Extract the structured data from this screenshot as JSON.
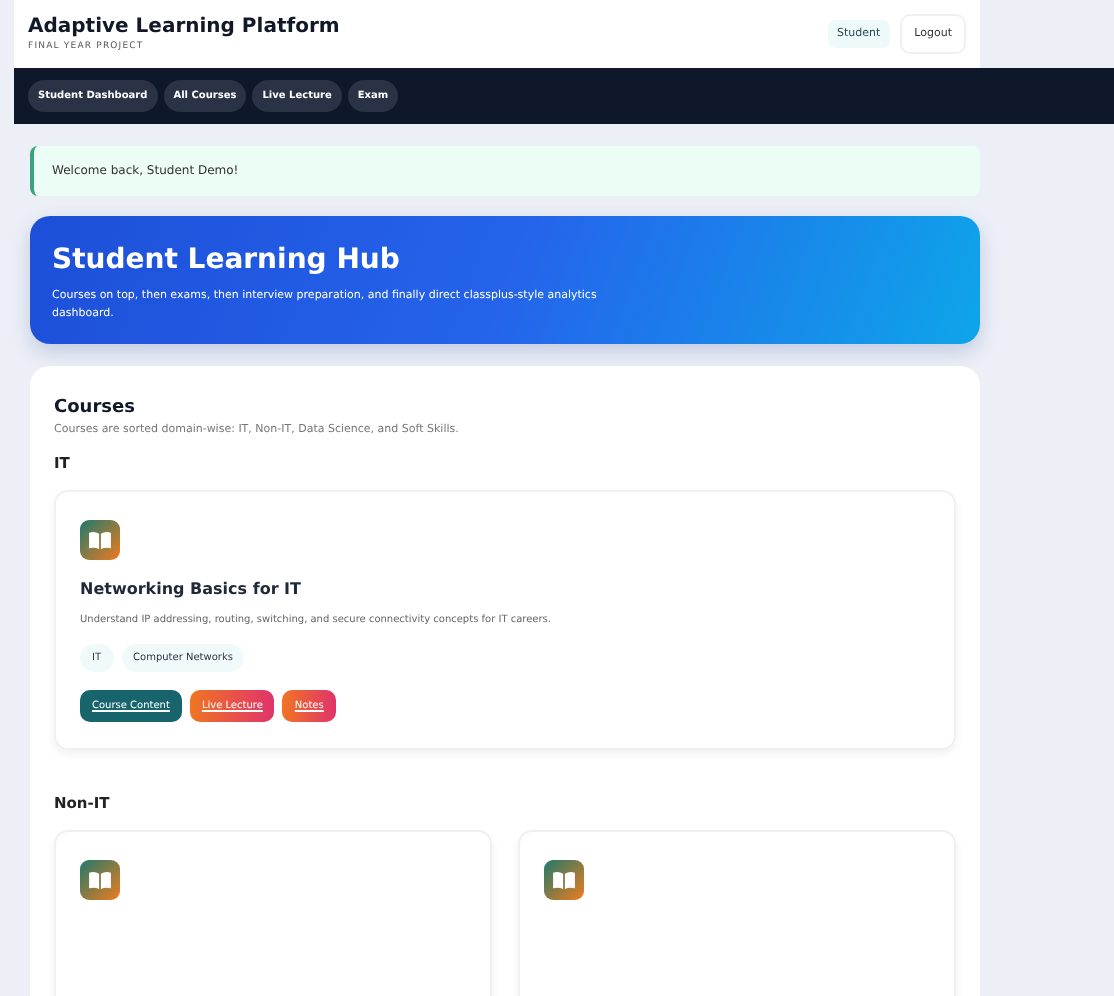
{
  "header": {
    "title": "Adaptive Learning Platform",
    "subtitle": "FINAL YEAR PROJECT",
    "role_badge": "Student",
    "logout": "Logout"
  },
  "nav": [
    {
      "label": "Student Dashboard"
    },
    {
      "label": "All Courses"
    },
    {
      "label": "Live Lecture"
    },
    {
      "label": "Exam"
    }
  ],
  "alert": "Welcome back, Student Demo!",
  "hero": {
    "title": "Student Learning Hub",
    "text": "Courses on top, then exams, then interview preparation, and finally direct classplus-style analytics dashboard."
  },
  "courses": {
    "title": "Courses",
    "subtitle": "Courses are sorted domain-wise: IT, Non-IT, Data Science, and Soft Skills.",
    "domains": [
      {
        "name": "IT",
        "cards": [
          {
            "kind": "course",
            "title": "Networking Basics for IT",
            "description": "Understand IP addressing, routing, switching, and secure connectivity concepts for IT careers.",
            "tags": [
              "IT",
              "Computer Networks"
            ],
            "actions": [
              {
                "label": "Course Content",
                "kind": "primary"
              },
              {
                "label": "Live Lecture",
                "kind": "accent"
              },
              {
                "label": "Notes",
                "kind": "accent"
              }
            ]
          }
        ]
      },
      {
        "name": "Non-IT",
        "cards": [
          {
            "kind": "course"
          },
          {
            "kind": "course"
          }
        ]
      }
    ]
  }
}
